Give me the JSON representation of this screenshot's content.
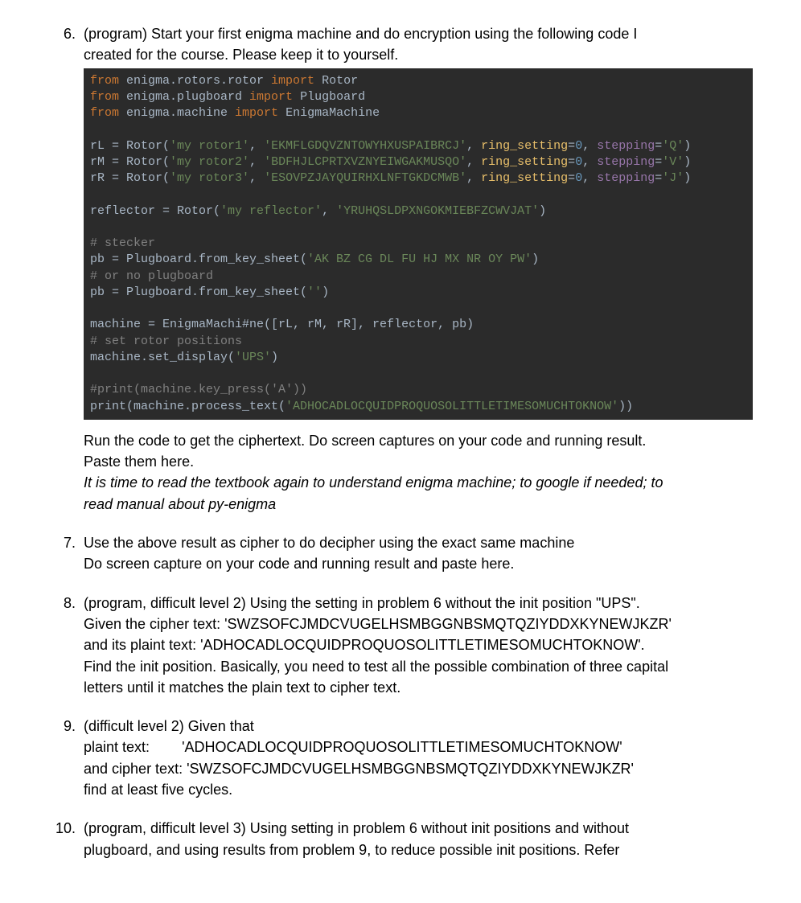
{
  "problems": {
    "p6": {
      "num": "6.",
      "intro1": "(program) Start your first enigma machine and do encryption using the following code I",
      "intro2": "created for the course. Please keep it to yourself.",
      "after1": "Run the code to get the ciphertext. Do screen captures on your code and running result.",
      "after2": "Paste them here.",
      "after3": "It is time to read the textbook again to understand enigma machine; to google if needed; to",
      "after4": "read manual about py-enigma"
    },
    "p7": {
      "num": "7.",
      "line1": "Use the above result as cipher to do decipher using the exact same machine",
      "line2": "Do screen capture on your code and running result and paste here."
    },
    "p8": {
      "num": "8.",
      "line1": "(program, difficult level 2) Using the setting in problem 6 without the init position \"UPS\".",
      "line2": "Given the cipher text: 'SWZSOFCJMDCVUGELHSMBGGNBSMQTQZIYDDXKYNEWJKZR'",
      "line3": "and its plaint text: 'ADHOCADLOCQUIDPROQUOSOLITTLETIMESOMUCHTOKNOW'.",
      "line4": "Find the init position. Basically, you need to test all the possible combination of three capital",
      "line5": "letters until it matches the plain text to cipher text."
    },
    "p9": {
      "num": "9.",
      "line1": "(difficult level 2) Given that",
      "line2_label": "plaint text:",
      "line2_val": "'ADHOCADLOCQUIDPROQUOSOLITTLETIMESOMUCHTOKNOW'",
      "line3_label": "and cipher text:",
      "line3_val": "'SWZSOFCJMDCVUGELHSMBGGNBSMQTQZIYDDXKYNEWJKZR'",
      "line4": "find at least five cycles."
    },
    "p10": {
      "num": "10.",
      "line1": "(program, difficult level 3) Using setting in problem 6 without init positions and without",
      "line2": "plugboard, and using results from problem 9, to reduce possible init positions. Refer"
    }
  },
  "code": {
    "l1_from": "from ",
    "l1_mod": "enigma.rotors.rotor ",
    "l1_imp": "import ",
    "l1_cls": "Rotor",
    "l2_from": "from ",
    "l2_mod": "enigma.plugboard ",
    "l2_imp": "import ",
    "l2_cls": "Plugboard",
    "l3_from": "from ",
    "l3_mod": "enigma.machine ",
    "l3_imp": "import ",
    "l3_cls": "EnigmaMachine",
    "l5_a": "rL = Rotor(",
    "l5_s1": "'my rotor1'",
    "l5_b": ", ",
    "l5_s2": "'EKMFLGDQVZNTOWYHXUSPAIBRCJ'",
    "l5_c": ", ",
    "l5_p": "ring_setting",
    "l5_d": "=",
    "l5_n": "0",
    "l5_e": ", ",
    "l5_st": "stepping",
    "l5_f": "=",
    "l5_sv": "'Q'",
    "l5_g": ")",
    "l6_a": "rM = Rotor(",
    "l6_s1": "'my rotor2'",
    "l6_b": ", ",
    "l6_s2": "'BDFHJLCPRTXVZNYEIWGAKMUSQO'",
    "l6_c": ", ",
    "l6_p": "ring_setting",
    "l6_d": "=",
    "l6_n": "0",
    "l6_e": ", ",
    "l6_st": "stepping",
    "l6_f": "=",
    "l6_sv": "'V'",
    "l6_g": ")",
    "l7_a": "rR = Rotor(",
    "l7_s1": "'my rotor3'",
    "l7_b": ", ",
    "l7_s2": "'ESOVPZJAYQUIRHXLNFTGKDCMWB'",
    "l7_c": ", ",
    "l7_p": "ring_setting",
    "l7_d": "=",
    "l7_n": "0",
    "l7_e": ", ",
    "l7_st": "stepping",
    "l7_f": "=",
    "l7_sv": "'J'",
    "l7_g": ")",
    "l9_a": "reflector = Rotor(",
    "l9_s1": "'my reflector'",
    "l9_b": ", ",
    "l9_s2": "'YRUHQSLDPXNGOKMIEBFZCWVJAT'",
    "l9_c": ")",
    "l11": "# stecker",
    "l12_a": "pb = Plugboard.from_key_sheet(",
    "l12_s": "'AK BZ CG DL FU HJ MX NR OY PW'",
    "l12_b": ")",
    "l13": "# or no plugboard",
    "l14_a": "pb = Plugboard.from_key_sheet(",
    "l14_s": "''",
    "l14_b": ")",
    "l16": "machine = EnigmaMachi#ne([rL, rM, rR], reflector, pb)",
    "l17": "# set rotor positions",
    "l18_a": "machine.set_display(",
    "l18_s": "'UPS'",
    "l18_b": ")",
    "l20": "#print(machine.key_press('A'))",
    "l21_a": "print(machine.process_text(",
    "l21_s": "'ADHOCADLOCQUIDPROQUOSOLITTLETIMESOMUCHTOKNOW'",
    "l21_b": "))"
  }
}
